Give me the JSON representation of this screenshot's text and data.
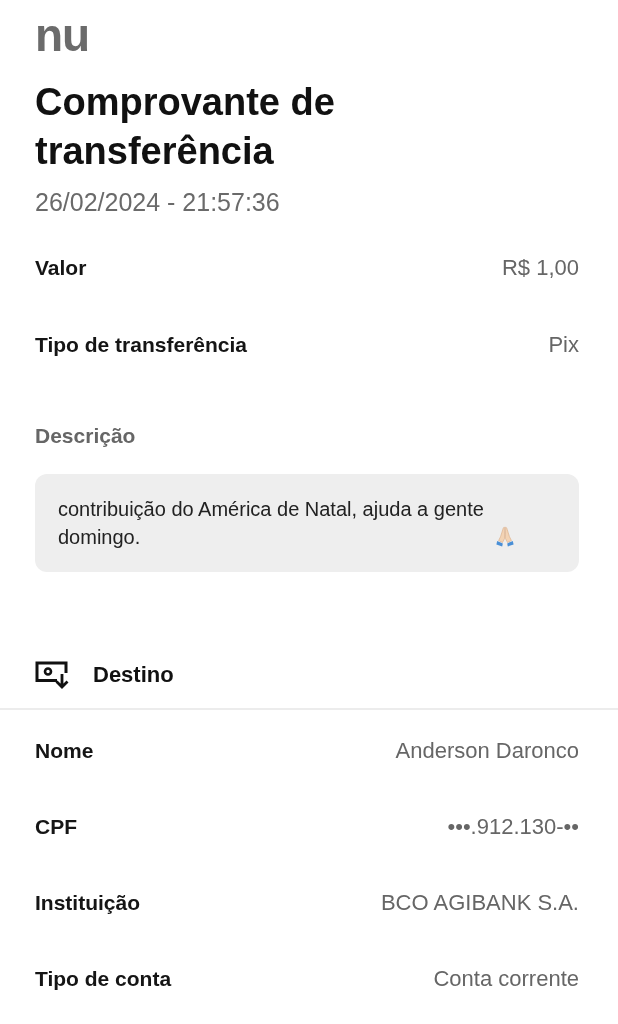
{
  "header": {
    "logo": "nu",
    "title": "Comprovante de transferência",
    "datetime": "26/02/2024 - 21:57:36"
  },
  "summary": [
    {
      "label": "Valor",
      "value": "R$ 1,00"
    },
    {
      "label": "Tipo de transferência",
      "value": "Pix"
    }
  ],
  "description": {
    "label": "Descrição",
    "text": "contribuição do América de Natal, ajuda a gente domingo."
  },
  "destination": {
    "title": "Destino",
    "fields": [
      {
        "label": "Nome",
        "value": "Anderson Daronco"
      },
      {
        "label": "CPF",
        "value": "•••.912.130-••"
      },
      {
        "label": "Instituição",
        "value": "BCO AGIBANK S.A."
      },
      {
        "label": "Tipo de conta",
        "value": "Conta corrente"
      }
    ]
  }
}
